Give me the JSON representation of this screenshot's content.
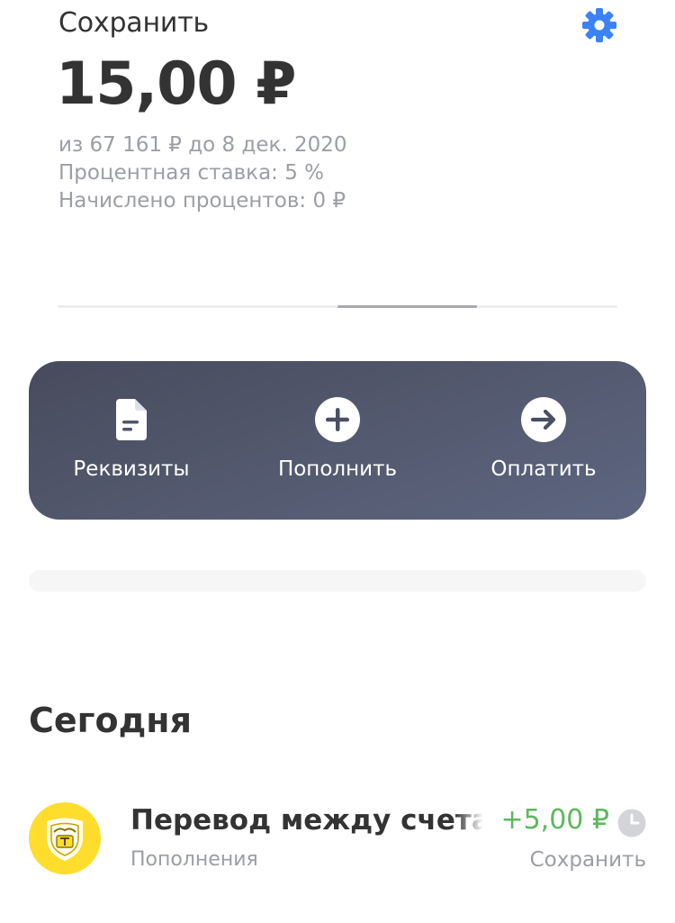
{
  "header": {
    "goal_name": "Сохранить",
    "settings_icon": "gear-icon",
    "accent_color": "#3a82f7"
  },
  "account": {
    "balance": "15,00 ₽",
    "goal_info": "из 67 161 ₽ до 8 дек. 2020",
    "interest_rate": "Процентная ставка: 5 %",
    "accrued_interest": "Начислено процентов: 0 ₽"
  },
  "pager": {
    "pages": 4,
    "active_page": 3
  },
  "actions": [
    {
      "label": "Реквизиты",
      "icon": "document-icon"
    },
    {
      "label": "Пополнить",
      "icon": "plus-circle-icon"
    },
    {
      "label": "Оплатить",
      "icon": "arrow-right-circle-icon"
    }
  ],
  "history": {
    "section_title": "Сегодня",
    "operations": [
      {
        "title": "Перевод между счетами",
        "category": "Пополнения",
        "amount": "+5,00 ₽",
        "amount_color": "#5cb85c",
        "status_icon": "clock-icon",
        "account": "Сохранить",
        "logo_icon": "bank-logo-icon",
        "logo_color": "#ffdd2d"
      }
    ]
  }
}
